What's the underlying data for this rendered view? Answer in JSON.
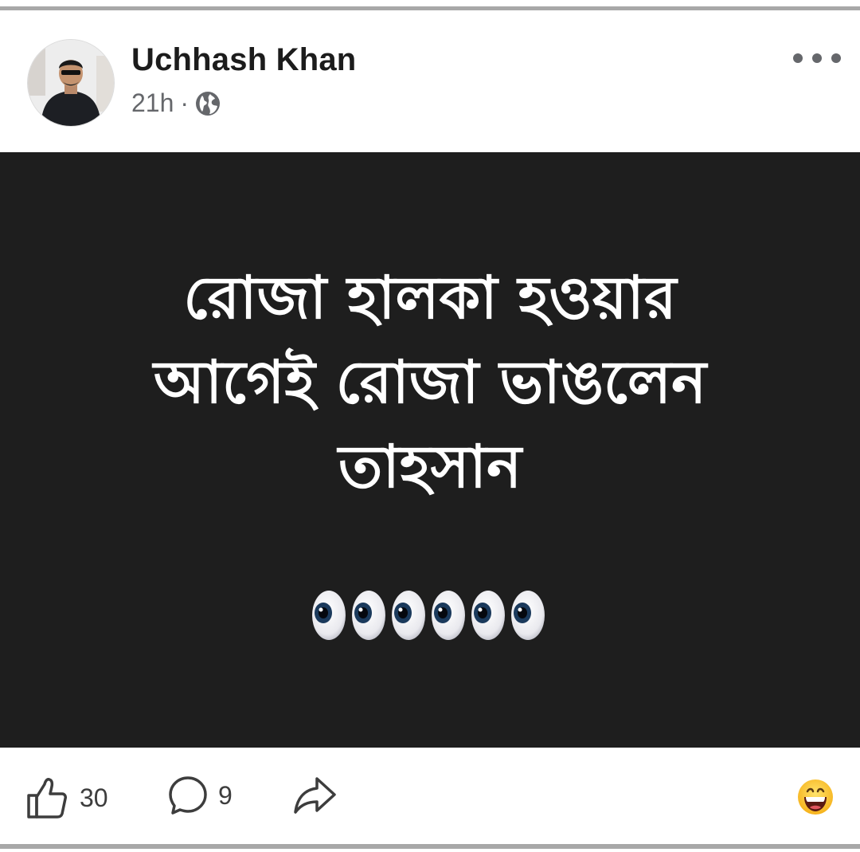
{
  "post": {
    "author": "Uchhash Khan",
    "time": "21h",
    "separator": "·",
    "audience_icon": "globe-icon",
    "more_icon": "more-options-icon",
    "headline_lines": [
      "রোজা হালকা হওয়ার",
      "আগেই রোজা ভাঙলেন",
      "তাহসান"
    ],
    "emoji_icon": "eyes-emoji",
    "emoji_count": 6,
    "background_color": "#1e1e1e",
    "text_color": "#ffffff"
  },
  "actions": {
    "likes": "30",
    "comments": "9",
    "like_icon": "thumbs-up-icon",
    "comment_icon": "comment-bubble-icon",
    "share_icon": "share-arrow-icon",
    "reaction_icon": "grinning-face-emoji"
  }
}
